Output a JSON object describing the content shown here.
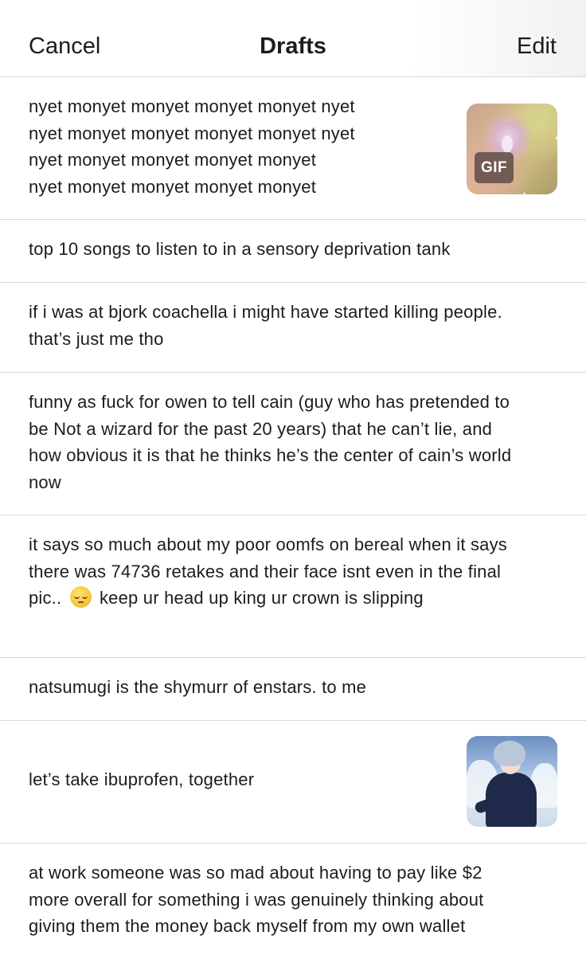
{
  "header": {
    "cancel_label": "Cancel",
    "title": "Drafts",
    "edit_label": "Edit"
  },
  "drafts": [
    {
      "lines": [
        "nyet monyet monyet monyet monyet nyet",
        "nyet monyet monyet monyet monyet nyet",
        "nyet monyet monyet monyet monyet",
        "nyet monyet monyet monyet monyet"
      ],
      "thumbnail": "gif",
      "badge": "GIF"
    },
    {
      "lines": [
        "top 10 songs to listen to in a sensory deprivation tank"
      ]
    },
    {
      "lines": [
        "if i was at bjork coachella i might have started killing people.",
        "that’s just me tho"
      ]
    },
    {
      "lines": [
        "funny as fuck for owen to tell cain (guy who has pretended to",
        "be Not a wizard for the past 20 years) that he can’t lie, and",
        "how obvious it is that he thinks he’s the center of cain’s world",
        "now"
      ]
    },
    {
      "lines": [
        "it says so much about my poor oomfs on bereal when it says",
        "there was 74736 retakes and their face isnt even in the final"
      ],
      "line3_before": "pic..",
      "emoji": "pensive-face",
      "line3_after": "keep ur head up king ur crown is slipping"
    },
    {
      "lines": [
        "natsumugi is the shymurr of enstars. to me"
      ]
    },
    {
      "lines": [
        "let’s take ibuprofen, together"
      ],
      "thumbnail": "image"
    },
    {
      "lines": [
        "at work someone was so mad about having to pay like $2",
        "more overall for something i was genuinely thinking about",
        "giving them the money back myself from my own wallet"
      ]
    }
  ]
}
